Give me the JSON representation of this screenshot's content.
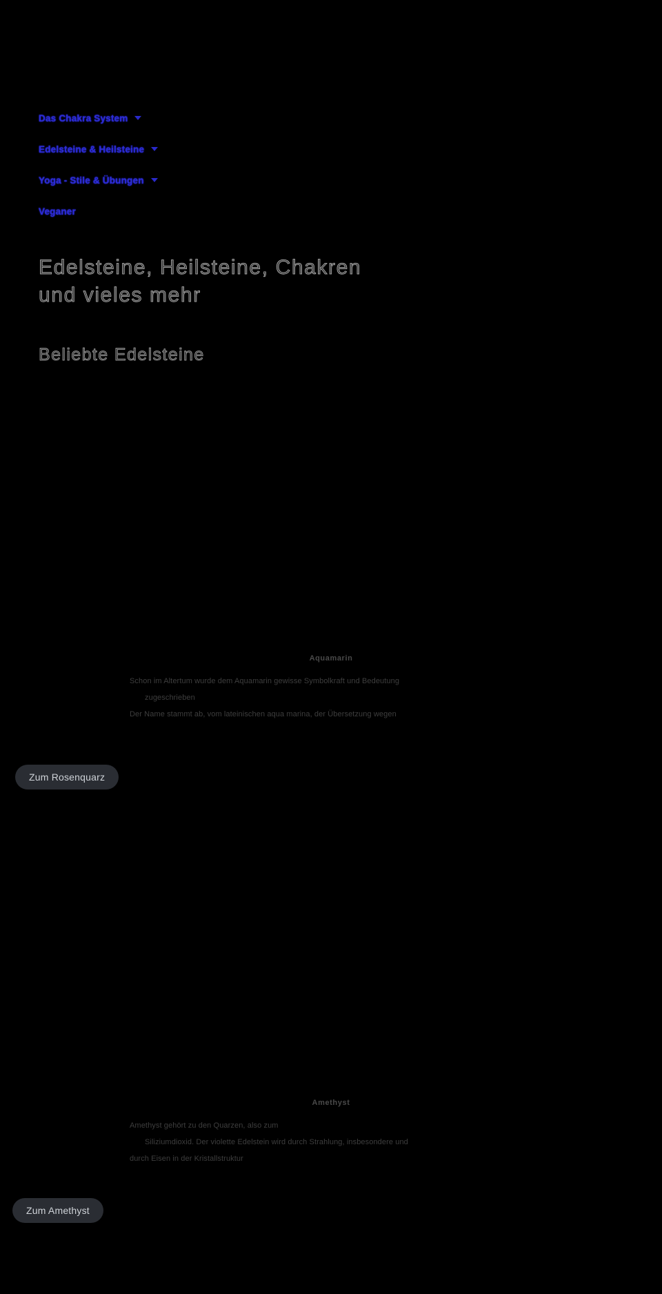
{
  "nav": {
    "items": [
      {
        "label": "Das Chakra System",
        "has_chevron": true,
        "icon": "chevron-down-icon"
      },
      {
        "label": "Edelsteine & Heilsteine",
        "has_chevron": true,
        "icon": "chevron-down-icon"
      },
      {
        "label": "Yoga - Stile & Übungen",
        "has_chevron": true,
        "icon": "chevron-down-icon"
      },
      {
        "label": "Veganer",
        "has_chevron": false,
        "icon": "chevron-down-icon"
      }
    ]
  },
  "hero": {
    "title": "Edelsteine, Heilsteine, Chakren\nund vieles mehr",
    "subtitle": "Beliebte Edelsteine"
  },
  "sections": [
    {
      "title": "Aquamarin",
      "paragraphs": [
        "Schon im Altertum wurde dem Aquamarin gewisse Symbolkraft und Bedeutung",
        "zugeschrieben",
        "Der Name stammt ab, vom lateinischen aqua marina, der Übersetzung wegen"
      ],
      "button_label": "Zum Rosenquarz"
    },
    {
      "title": "Amethyst",
      "paragraphs": [
        "Amethyst gehört zu den Quarzen, also zum",
        "Siliziumdioxid. Der violette Edelstein wird durch Strahlung, insbesondere und",
        "durch Eisen in der Kristallstruktur"
      ],
      "button_label": "Zum Amethyst"
    }
  ],
  "colors": {
    "background": "#000000",
    "nav_link": "#2b2bd6",
    "heading_outline": "#b9b9b9",
    "button_bg": "#2a2d33",
    "button_text": "#cfd3d8",
    "body_text": "#3e3e3e"
  }
}
